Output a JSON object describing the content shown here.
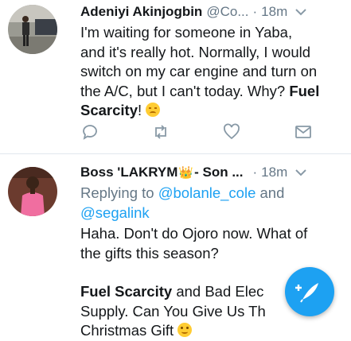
{
  "colors": {
    "accent": "#1da1f2",
    "text": "#14171a",
    "muted": "#657786",
    "divider": "#e1e8ed"
  },
  "tweets": [
    {
      "name": "Adeniyi Akinjogbin",
      "handle": "@Co...",
      "dot": "·",
      "time": "18m",
      "text_lines": [
        "I'm waiting for someone in Yaba,",
        "and it's really hot. Normally, I would",
        "switch on my car engine and turn on",
        "the A/C, but I can't today. Why?"
      ],
      "bold_1": "Fuel",
      "bold_2": "Scarcity",
      "after_bold": "!",
      "emoji": "unamused-face-emoji",
      "actions": [
        "reply-icon",
        "retweet-icon",
        "like-icon",
        "direct-message-icon"
      ]
    },
    {
      "name": "Boss 'LAKRYM",
      "crown": "👑",
      "name_suffix": "- Son ...",
      "dot": "·",
      "time": "18m",
      "replying_prefix": "Replying to",
      "reply_to_1": "@bolanle_cole",
      "reply_and": "and",
      "reply_to_2": "@segalink",
      "line_1": "Haha. Don't do Ojoro now. What of",
      "line_2": "the gifts this season?",
      "bold": "Fuel Scarcity",
      "line_3_rest": "and Bad Elec",
      "line_4": "Supply. Can You Give Us Th",
      "line_5": "Christmas Gift",
      "emoji": "smiling-face-emoji"
    }
  ],
  "fab": {
    "icon": "compose-feather-icon"
  }
}
